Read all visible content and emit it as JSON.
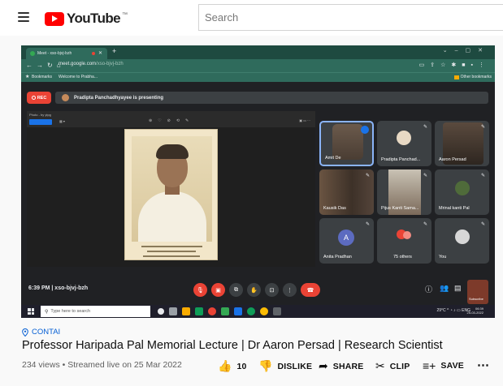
{
  "masthead": {
    "logo_text": "YouTube",
    "logo_region": "™",
    "search_placeholder": "Search"
  },
  "browser": {
    "tab_title": "Meet - xso-bjvj-bzh",
    "url_host": "meet.google.com",
    "url_path": "/xso-bjvj-bzh",
    "bookmarks": [
      "Bookmarks",
      "Welcome to Prabha..."
    ],
    "other_bookmarks": "Other bookmarks"
  },
  "meet": {
    "rec_label": "REC",
    "presenting_text": "Pradipta Panchadhyayee is presenting",
    "viewer_title": "Photo - by ytpg",
    "time_code": "6:39 PM | xso-bjvj-bzh",
    "participants": [
      {
        "name": "Amit De"
      },
      {
        "name": "Pradipta Panchad..."
      },
      {
        "name": "Aaron Persad"
      },
      {
        "name": "Kausik Das"
      },
      {
        "name": "Pijus Kanti Sama..."
      },
      {
        "name": "Mrinal kanti Pal"
      },
      {
        "name": "Anita Pradhan",
        "initial": "A"
      },
      {
        "name": "75 others"
      },
      {
        "name": "You"
      }
    ],
    "subscribe": "Subscribe",
    "colors": {
      "accent": "#8ab4f8",
      "danger": "#ea4335",
      "tile": "#3c4043"
    }
  },
  "taskbar": {
    "search_placeholder": "Type here to search",
    "weather": "29°C",
    "lang": "ENG",
    "clock_time": "06:39",
    "clock_date": "25-03-2022"
  },
  "video": {
    "location": "CONTAI",
    "title": "Professor Haripada Pal Memorial Lecture | Dr Aaron Persad | Research Scientist",
    "meta": "234 views • Streamed live on 25 Mar 2022",
    "like_count": "10",
    "dislike_label": "DISLIKE",
    "share_label": "SHARE",
    "clip_label": "CLIP",
    "save_label": "SAVE",
    "colors": {
      "link": "#065fd4",
      "brand": "#ff0000"
    }
  }
}
